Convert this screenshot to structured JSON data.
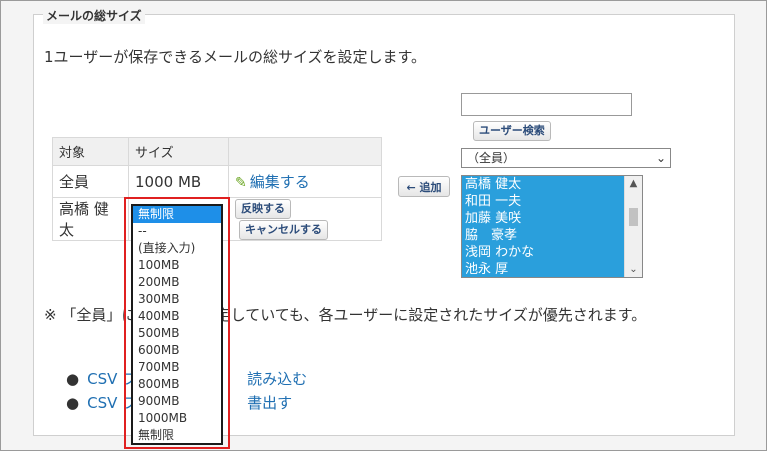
{
  "section": {
    "legend": "メールの総サイズ"
  },
  "intro": "1ユーザーが保存できるメールの総サイズを設定します。",
  "table": {
    "headers": [
      "対象",
      "サイズ"
    ],
    "rows": [
      {
        "target": "全員",
        "size": "1000 MB",
        "edit_label": "編集する"
      },
      {
        "target": "高橋 健太",
        "apply_label": "反映する",
        "cancel_label": "キャンセルする"
      }
    ]
  },
  "size_dropdown": {
    "selected": "無制限",
    "options": [
      "無制限",
      "--",
      "(直接入力)",
      "100MB",
      "200MB",
      "300MB",
      "400MB",
      "500MB",
      "600MB",
      "700MB",
      "800MB",
      "900MB",
      "1000MB",
      "無制限"
    ]
  },
  "add_button": "← 追加",
  "user_selector": {
    "search_value": "",
    "search_button": "ユーザー検索",
    "group_selected": "（全員）",
    "users": [
      "高橋 健太",
      "和田 一夫",
      "加藤 美咲",
      "脇　豪孝",
      "浅岡 わかな",
      "池永 厚"
    ]
  },
  "note": "※ 「全員」に サイズを設定していても、各ユーザーに設定されたサイズが優先されます。",
  "links": [
    {
      "text": "CSV フ",
      "text2": "読み込む"
    },
    {
      "text": "CSV フ",
      "text2": "書出す"
    }
  ],
  "colors": {
    "highlight": "#e02020",
    "selection": "#1e8fe8",
    "link": "#1f6fb2"
  }
}
